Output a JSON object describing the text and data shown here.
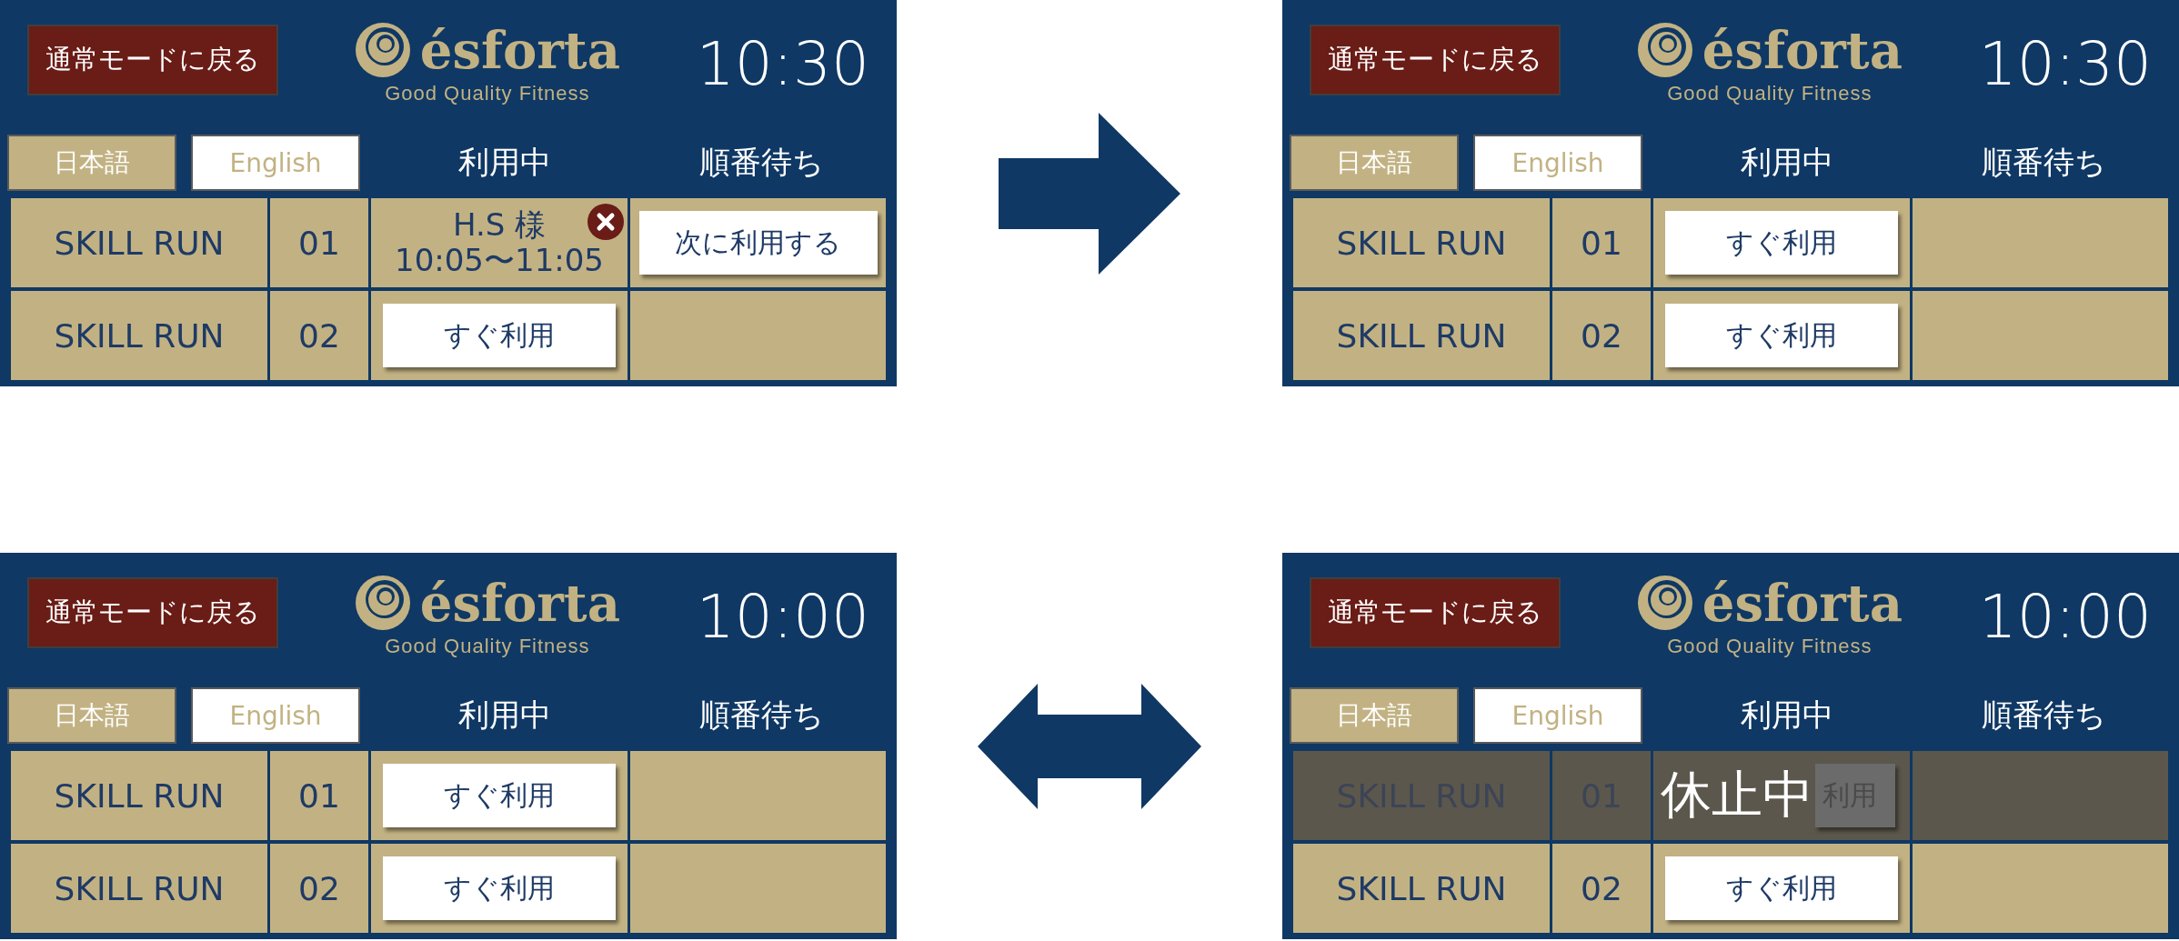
{
  "steps": [
    {
      "from": {
        "return_button": "通常モードに戻る",
        "logo": {
          "name": "ésforta",
          "tagline": "Good Quality Fitness"
        },
        "clock": "10:30",
        "languages": [
          {
            "label": "日本語",
            "selected": true
          },
          {
            "label": "English",
            "selected": false
          }
        ],
        "columns": [
          "利用中",
          "順番待ち"
        ],
        "rows": [
          {
            "machine": "SKILL RUN",
            "number": "01",
            "paused": false,
            "in_use": {
              "kind": "user",
              "name": "H.S 様",
              "time": "10:05〜11:05"
            },
            "waiting": {
              "kind": "button",
              "label": "次に利用する"
            }
          },
          {
            "machine": "SKILL RUN",
            "number": "02",
            "paused": false,
            "in_use": {
              "kind": "button",
              "label": "すぐ利用"
            }
          }
        ]
      },
      "arrow": {
        "kind": "right"
      },
      "to": {
        "return_button": "通常モードに戻る",
        "logo": {
          "name": "ésforta",
          "tagline": "Good Quality Fitness"
        },
        "clock": "10:30",
        "languages": [
          {
            "label": "日本語",
            "selected": true
          },
          {
            "label": "English",
            "selected": false
          }
        ],
        "columns": [
          "利用中",
          "順番待ち"
        ],
        "rows": [
          {
            "machine": "SKILL RUN",
            "number": "01",
            "paused": false,
            "in_use": {
              "kind": "button",
              "label": "すぐ利用"
            }
          },
          {
            "machine": "SKILL RUN",
            "number": "02",
            "paused": false,
            "in_use": {
              "kind": "button",
              "label": "すぐ利用"
            }
          }
        ]
      }
    },
    {
      "from": {
        "return_button": "通常モードに戻る",
        "logo": {
          "name": "ésforta",
          "tagline": "Good Quality Fitness"
        },
        "clock": "10:00",
        "languages": [
          {
            "label": "日本語",
            "selected": true
          },
          {
            "label": "English",
            "selected": false
          }
        ],
        "columns": [
          "利用中",
          "順番待ち"
        ],
        "rows": [
          {
            "machine": "SKILL RUN",
            "number": "01",
            "paused": false,
            "in_use": {
              "kind": "button",
              "label": "すぐ利用"
            }
          },
          {
            "machine": "SKILL RUN",
            "number": "02",
            "paused": false,
            "in_use": {
              "kind": "button",
              "label": "すぐ利用"
            }
          }
        ]
      },
      "arrow": {
        "kind": "both"
      },
      "to": {
        "return_button": "通常モードに戻る",
        "logo": {
          "name": "ésforta",
          "tagline": "Good Quality Fitness"
        },
        "clock": "10:00",
        "languages": [
          {
            "label": "日本語",
            "selected": true
          },
          {
            "label": "English",
            "selected": false
          }
        ],
        "columns": [
          "利用中",
          "順番待ち"
        ],
        "rows": [
          {
            "machine": "SKILL RUN",
            "number": "01",
            "paused": true,
            "paused_label": "休止中",
            "in_use": {
              "kind": "covered_button",
              "label": "利用"
            }
          },
          {
            "machine": "SKILL RUN",
            "number": "02",
            "paused": false,
            "in_use": {
              "kind": "button",
              "label": "すぐ利用"
            }
          }
        ]
      }
    }
  ]
}
